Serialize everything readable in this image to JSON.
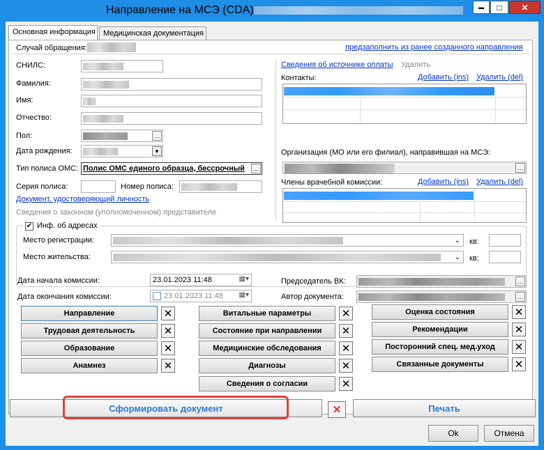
{
  "window": {
    "title": "Направление на МСЭ (CDA) -",
    "minimize": "▬",
    "maximize": "□",
    "close": "✕"
  },
  "tabs": [
    "Основная информация",
    "Медицинская документация"
  ],
  "case": {
    "label": "Случай обращения:",
    "prefill_link": "предзаполнить из ранее созданного направления"
  },
  "left": {
    "snils": "СНИЛС:",
    "surname": "Фамилия:",
    "name": "Имя:",
    "patronymic": "Отчество:",
    "sex": "Пол:",
    "birth_date": "Дата рождения:",
    "policy_type_label": "Тип полиса ОМС:",
    "policy_type_value": "Полис ОМС единого образца, бессрочный",
    "policy_series": "Серия полиса:",
    "policy_number": "Номер полиса:",
    "identity_doc_link": "Документ, удостоверяющий личность",
    "legal_rep": "Сведения о законном (уполномоченном) представителе"
  },
  "right": {
    "payment_link": "Сведения об источнике оплаты",
    "payment_delete": "Удалить",
    "contacts_label": "Контакты:",
    "add_ins": "Добавить (ins)",
    "del_del": "Удалить (del)",
    "org_label": "Организация (МО или его филиал), направившая на МСЭ:",
    "commission_label": "Члены врачебной комиссии:"
  },
  "address": {
    "group_label": "Инф. об адресах",
    "registration": "Место регистрации:",
    "residence": "Место жительства:",
    "apt": "кв:"
  },
  "commission": {
    "start_label": "Дата начала комиссии:",
    "start_value": "23.01.2023 11:48",
    "end_label": "Дата окончания комиссии:",
    "end_value": "23.01.2023 11:48",
    "chairman_label": "Председатель ВК:",
    "author_label": "Автор документа:"
  },
  "buttons": {
    "col1": [
      "Направление",
      "Трудовая деятельность",
      "Образование",
      "Анамнез"
    ],
    "col2": [
      "Витальные параметры",
      "Состояние при направлении",
      "Медицинские обследования",
      "Диагнозы",
      "Сведения о согласии"
    ],
    "col3": [
      "Оценка состояния",
      "Рекомендации",
      "Посторонний спец. мед.уход",
      "Связанные документы"
    ],
    "x": "✕"
  },
  "bottom": {
    "generate": "Сформировать документ",
    "print": "Печать",
    "ok": "Ok",
    "cancel": "Отмена"
  },
  "colors": {
    "titlebar": "#1f8ee6",
    "selection": "#3399ff",
    "highlight": "#e0403c",
    "link": "#0033cc"
  }
}
